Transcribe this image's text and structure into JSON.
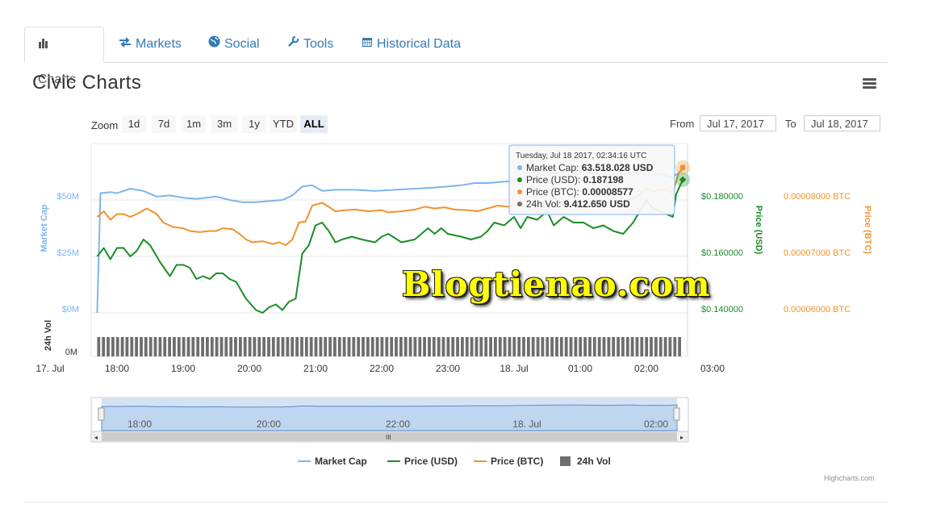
{
  "tabs": [
    {
      "label": "Charts",
      "icon": "bar-chart-icon",
      "active": true
    },
    {
      "label": "Markets",
      "icon": "exchange-arrows-icon",
      "active": false
    },
    {
      "label": "Social",
      "icon": "globe-icon",
      "active": false
    },
    {
      "label": "Tools",
      "icon": "wrench-icon",
      "active": false
    },
    {
      "label": "Historical Data",
      "icon": "calendar-icon",
      "active": false
    }
  ],
  "title": "Civic Charts",
  "zoom": {
    "label": "Zoom",
    "buttons": [
      "1d",
      "7d",
      "1m",
      "3m",
      "1y",
      "YTD",
      "ALL"
    ],
    "active": "ALL"
  },
  "date_range": {
    "from_label": "From",
    "from_value": "Jul 17, 2017",
    "to_label": "To",
    "to_value": "Jul 18, 2017"
  },
  "watermark": "Blogtienao.com",
  "credits": "Highcharts.com",
  "colors": {
    "market_cap": "#7cb5ec",
    "price_usd": "#1a8d25",
    "price_btc": "#f0932b",
    "volume": "#6e6e6e",
    "tab_link": "#337ab7"
  },
  "tooltip": {
    "header": "Tuesday, Jul 18 2017, 02:34:16 UTC",
    "rows": [
      {
        "label": "Market Cap:",
        "value": "63.518.028 USD",
        "color": "#7cb5ec"
      },
      {
        "label": "Price (USD):",
        "value": "0.187198",
        "color": "#1a8d25"
      },
      {
        "label": "Price (BTC):",
        "value": "0.00008577",
        "color": "#f0932b"
      },
      {
        "label": "24h Vol:",
        "value": "9.412.650 USD",
        "color": "#6e6e6e"
      }
    ]
  },
  "chart_data": {
    "type": "line",
    "x_axis": {
      "ticks": [
        "17. Jul",
        "18:00",
        "19:00",
        "20:00",
        "21:00",
        "22:00",
        "23:00",
        "18. Jul",
        "01:00",
        "02:00",
        "03:00"
      ],
      "range_hours": [
        17.0,
        27.0
      ]
    },
    "y_axes": [
      {
        "title": "Market Cap",
        "ticks": [
          "$0M",
          "$25M",
          "$50M"
        ],
        "range": [
          0,
          75000000
        ],
        "color": "#7cb5ec"
      },
      {
        "title": "Price (USD)",
        "ticks": [
          "$0.140000",
          "$0.160000",
          "$0.180000"
        ],
        "range": [
          0.14,
          0.2
        ],
        "color": "#1a8d25"
      },
      {
        "title": "Price (BTC)",
        "ticks": [
          "0.00006000 BTC",
          "0.00007000 BTC",
          "0.00008000 BTC"
        ],
        "range": [
          6e-05,
          9e-05
        ],
        "color": "#f0932b"
      },
      {
        "title": "24h Vol",
        "ticks": [
          "0M"
        ],
        "color": "#6e6e6e"
      }
    ],
    "series": [
      {
        "name": "Market Cap",
        "axis": 0,
        "color": "#7cb5ec",
        "points": [
          [
            17.7,
            0
          ],
          [
            17.75,
            53000000
          ],
          [
            17.9,
            53500000
          ],
          [
            18.0,
            53000000
          ],
          [
            18.2,
            55000000
          ],
          [
            18.4,
            54000000
          ],
          [
            18.6,
            51500000
          ],
          [
            18.8,
            52000000
          ],
          [
            19.0,
            51000000
          ],
          [
            19.2,
            50500000
          ],
          [
            19.5,
            51500000
          ],
          [
            19.7,
            50000000
          ],
          [
            19.9,
            49000000
          ],
          [
            20.1,
            49000000
          ],
          [
            20.3,
            49500000
          ],
          [
            20.5,
            50000000
          ],
          [
            20.65,
            52000000
          ],
          [
            20.8,
            56000000
          ],
          [
            20.95,
            56500000
          ],
          [
            21.1,
            54000000
          ],
          [
            21.3,
            54500000
          ],
          [
            21.6,
            54500000
          ],
          [
            21.9,
            54000000
          ],
          [
            22.2,
            54500000
          ],
          [
            22.5,
            55000000
          ],
          [
            22.8,
            55500000
          ],
          [
            23.0,
            56000000
          ],
          [
            23.2,
            56500000
          ],
          [
            23.4,
            57500000
          ],
          [
            23.6,
            57500000
          ],
          [
            23.8,
            58000000
          ],
          [
            24.0,
            58500000
          ],
          [
            24.15,
            60000000
          ],
          [
            24.3,
            61000000
          ],
          [
            24.5,
            61500000
          ],
          [
            24.7,
            62000000
          ],
          [
            24.9,
            62500000
          ],
          [
            25.1,
            62000000
          ],
          [
            25.3,
            61500000
          ],
          [
            25.5,
            61000000
          ],
          [
            25.7,
            62000000
          ],
          [
            25.9,
            62500000
          ],
          [
            26.0,
            60500000
          ],
          [
            26.2,
            61500000
          ],
          [
            26.4,
            60000000
          ],
          [
            26.55,
            63518028
          ]
        ]
      },
      {
        "name": "Price (USD)",
        "axis": 1,
        "color": "#1a8d25",
        "points": [
          [
            17.7,
            0.16
          ],
          [
            17.8,
            0.163
          ],
          [
            17.9,
            0.159
          ],
          [
            18.0,
            0.163
          ],
          [
            18.1,
            0.163
          ],
          [
            18.2,
            0.16
          ],
          [
            18.3,
            0.162
          ],
          [
            18.4,
            0.166
          ],
          [
            18.5,
            0.164
          ],
          [
            18.65,
            0.158
          ],
          [
            18.8,
            0.153
          ],
          [
            18.9,
            0.157
          ],
          [
            19.0,
            0.157
          ],
          [
            19.1,
            0.156
          ],
          [
            19.2,
            0.152
          ],
          [
            19.3,
            0.153
          ],
          [
            19.4,
            0.152
          ],
          [
            19.5,
            0.154
          ],
          [
            19.6,
            0.154
          ],
          [
            19.7,
            0.152
          ],
          [
            19.8,
            0.151
          ],
          [
            19.95,
            0.145
          ],
          [
            20.1,
            0.141
          ],
          [
            20.2,
            0.14
          ],
          [
            20.3,
            0.142
          ],
          [
            20.4,
            0.143
          ],
          [
            20.5,
            0.141
          ],
          [
            20.6,
            0.144
          ],
          [
            20.7,
            0.145
          ],
          [
            20.8,
            0.161
          ],
          [
            20.9,
            0.164
          ],
          [
            21.0,
            0.171
          ],
          [
            21.1,
            0.172
          ],
          [
            21.2,
            0.169
          ],
          [
            21.3,
            0.165
          ],
          [
            21.4,
            0.166
          ],
          [
            21.55,
            0.167
          ],
          [
            21.7,
            0.166
          ],
          [
            21.9,
            0.165
          ],
          [
            22.0,
            0.167
          ],
          [
            22.1,
            0.168
          ],
          [
            22.3,
            0.165
          ],
          [
            22.5,
            0.166
          ],
          [
            22.7,
            0.17
          ],
          [
            22.8,
            0.168
          ],
          [
            22.9,
            0.17
          ],
          [
            23.0,
            0.168
          ],
          [
            23.2,
            0.167
          ],
          [
            23.35,
            0.166
          ],
          [
            23.5,
            0.167
          ],
          [
            23.6,
            0.169
          ],
          [
            23.7,
            0.172
          ],
          [
            23.85,
            0.171
          ],
          [
            24.0,
            0.174
          ],
          [
            24.1,
            0.17
          ],
          [
            24.2,
            0.174
          ],
          [
            24.35,
            0.173
          ],
          [
            24.5,
            0.176
          ],
          [
            24.6,
            0.171
          ],
          [
            24.75,
            0.174
          ],
          [
            24.9,
            0.172
          ],
          [
            25.05,
            0.172
          ],
          [
            25.2,
            0.17
          ],
          [
            25.35,
            0.171
          ],
          [
            25.5,
            0.169
          ],
          [
            25.65,
            0.168
          ],
          [
            25.8,
            0.172
          ],
          [
            25.9,
            0.176
          ],
          [
            26.0,
            0.18
          ],
          [
            26.1,
            0.177
          ],
          [
            26.2,
            0.176
          ],
          [
            26.3,
            0.175
          ],
          [
            26.4,
            0.174
          ],
          [
            26.45,
            0.182
          ],
          [
            26.55,
            0.187198
          ]
        ]
      },
      {
        "name": "Price (BTC)",
        "axis": 2,
        "color": "#f0932b",
        "points": [
          [
            17.7,
            7.7e-05
          ],
          [
            17.8,
            7.8e-05
          ],
          [
            17.9,
            7.65e-05
          ],
          [
            18.0,
            7.75e-05
          ],
          [
            18.1,
            7.75e-05
          ],
          [
            18.2,
            7.7e-05
          ],
          [
            18.3,
            7.75e-05
          ],
          [
            18.45,
            7.85e-05
          ],
          [
            18.6,
            7.75e-05
          ],
          [
            18.7,
            7.6e-05
          ],
          [
            18.85,
            7.52e-05
          ],
          [
            19.0,
            7.5e-05
          ],
          [
            19.1,
            7.45e-05
          ],
          [
            19.25,
            7.43e-05
          ],
          [
            19.4,
            7.45e-05
          ],
          [
            19.5,
            7.45e-05
          ],
          [
            19.6,
            7.5e-05
          ],
          [
            19.75,
            7.48e-05
          ],
          [
            19.85,
            7.4e-05
          ],
          [
            19.95,
            7.3e-05
          ],
          [
            20.05,
            7.25e-05
          ],
          [
            20.2,
            7.27e-05
          ],
          [
            20.35,
            7.22e-05
          ],
          [
            20.45,
            7.25e-05
          ],
          [
            20.55,
            7.2e-05
          ],
          [
            20.65,
            7.3e-05
          ],
          [
            20.75,
            7.6e-05
          ],
          [
            20.85,
            7.62e-05
          ],
          [
            20.95,
            7.9e-05
          ],
          [
            21.1,
            7.95e-05
          ],
          [
            21.2,
            7.88e-05
          ],
          [
            21.3,
            7.8e-05
          ],
          [
            21.45,
            7.82e-05
          ],
          [
            21.6,
            7.83e-05
          ],
          [
            21.8,
            7.8e-05
          ],
          [
            22.0,
            7.82e-05
          ],
          [
            22.1,
            7.78e-05
          ],
          [
            22.3,
            7.8e-05
          ],
          [
            22.5,
            7.83e-05
          ],
          [
            22.65,
            7.88e-05
          ],
          [
            22.8,
            7.85e-05
          ],
          [
            22.95,
            7.87e-05
          ],
          [
            23.1,
            7.83e-05
          ],
          [
            23.3,
            7.82e-05
          ],
          [
            23.45,
            7.8e-05
          ],
          [
            23.6,
            7.85e-05
          ],
          [
            23.75,
            7.9e-05
          ],
          [
            23.9,
            7.88e-05
          ],
          [
            24.05,
            7.92e-05
          ],
          [
            24.2,
            7.9e-05
          ],
          [
            24.35,
            7.92e-05
          ],
          [
            24.5,
            7.92e-05
          ],
          [
            24.6,
            7.88e-05
          ],
          [
            24.8,
            7.93e-05
          ],
          [
            24.95,
            7.95e-05
          ],
          [
            25.1,
            7.94e-05
          ],
          [
            25.25,
            7.97e-05
          ],
          [
            25.4,
            7.94e-05
          ],
          [
            25.55,
            7.98e-05
          ],
          [
            25.7,
            8e-05
          ],
          [
            25.85,
            8.05e-05
          ],
          [
            26.0,
            8.2e-05
          ],
          [
            26.1,
            8.15e-05
          ],
          [
            26.2,
            8.18e-05
          ],
          [
            26.3,
            8.18e-05
          ],
          [
            26.4,
            8.12e-05
          ],
          [
            26.48,
            8.45e-05
          ],
          [
            26.55,
            8.577e-05
          ]
        ]
      }
    ],
    "volume": {
      "name": "24h Vol",
      "bars": 124,
      "start": 17.7,
      "end": 26.55,
      "value_latest": 9412650
    },
    "navigator_ticks": [
      "18:00",
      "20:00",
      "22:00",
      "18. Jul",
      "02:00"
    ],
    "legend": [
      {
        "name": "Market Cap",
        "color": "#7cb5ec",
        "symbol": "line"
      },
      {
        "name": "Price (USD)",
        "color": "#1a8d25",
        "symbol": "line"
      },
      {
        "name": "Price (BTC)",
        "color": "#f0932b",
        "symbol": "line"
      },
      {
        "name": "24h Vol",
        "color": "#6e6e6e",
        "symbol": "square"
      }
    ],
    "grid": true,
    "legend_position": "bottom-center"
  }
}
